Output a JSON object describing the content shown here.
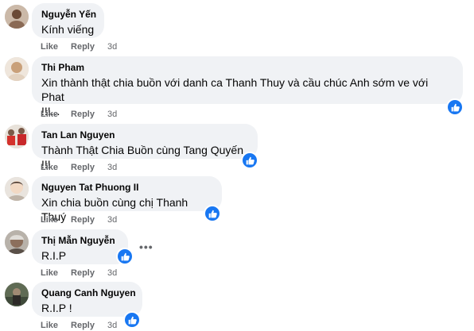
{
  "comments": [
    {
      "author": "Nguyễn Yến",
      "text": "Kính viếng",
      "like": "Like",
      "reply": "Reply",
      "time": "3d"
    },
    {
      "author": "Thi Pham",
      "text_line1": "Xin thành thật chia buồn với danh ca Thanh Thuy và cầu chúc Anh sớm ve với Phat",
      "text_line2": "!!!...",
      "like": "Like",
      "reply": "Reply",
      "time": "3d"
    },
    {
      "author": "Tan Lan Nguyen",
      "text": "Thành Thật Chia Buồn cùng Tang Quyến !!!",
      "like": "Like",
      "reply": "Reply",
      "time": "3d"
    },
    {
      "author": "Nguyen Tat Phuong II",
      "text": "Xin chia buồn cùng chị Thanh Thuý",
      "like": "Like",
      "reply": "Reply",
      "time": "3d"
    },
    {
      "author": "Thị Mẫn Nguyễn",
      "text": "R.I.P",
      "like": "Like",
      "reply": "Reply",
      "time": "3d"
    },
    {
      "author": "Quang Canh Nguyen",
      "text": "R.I.P !",
      "like": "Like",
      "reply": "Reply",
      "time": "3d"
    }
  ],
  "more_options": "•••",
  "colors": {
    "bubble": "#f0f2f5",
    "like_blue": "#1877f2",
    "meta_gray": "#65676b"
  },
  "icons": {
    "reaction": "thumbs-up-icon",
    "more": "more-options-icon"
  }
}
